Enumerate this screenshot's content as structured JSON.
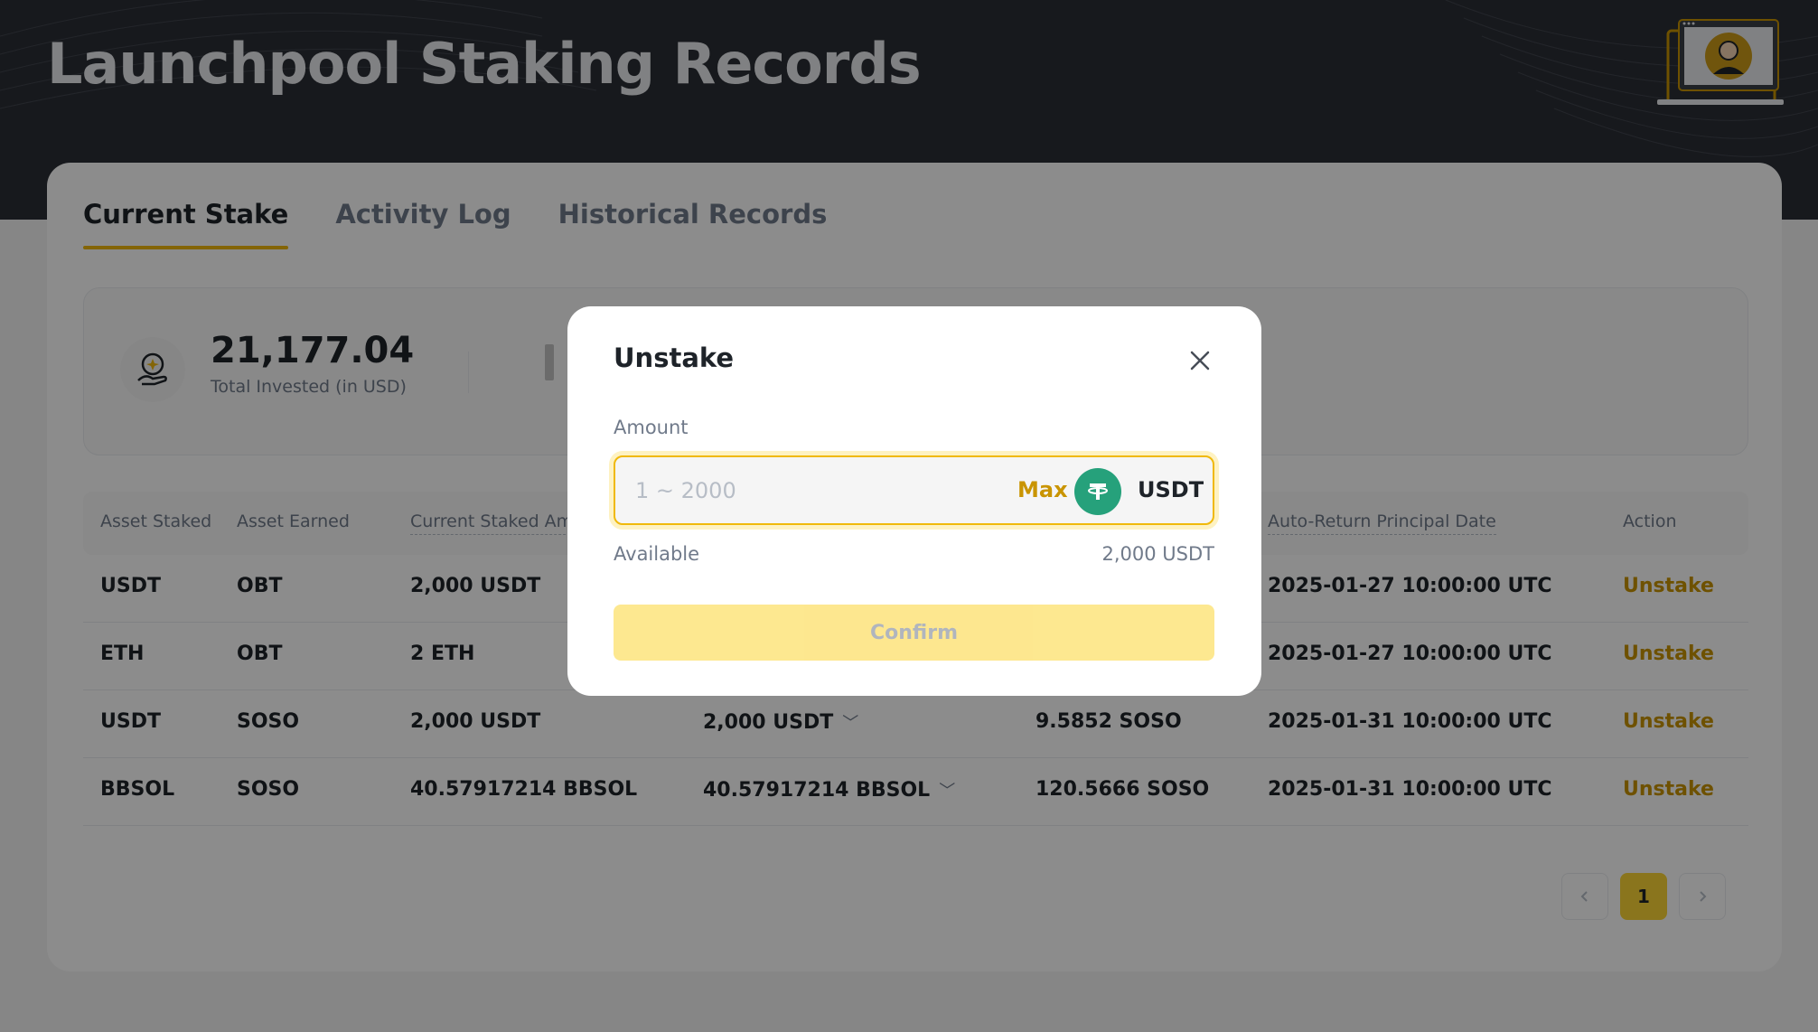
{
  "page": {
    "title": "Launchpool Staking Records"
  },
  "tabs": [
    {
      "label": "Current Stake",
      "active": true
    },
    {
      "label": "Activity Log",
      "active": false
    },
    {
      "label": "Historical Records",
      "active": false
    }
  ],
  "summary": {
    "total_invested_value": "21,177.04",
    "total_invested_label": "Total Invested (in USD)"
  },
  "table": {
    "headers": {
      "asset_staked": "Asset Staked",
      "asset_earned": "Asset Earned",
      "current_staked_amount": "Current Staked Amo",
      "auto_return_date": "Auto-Return Principal Date",
      "action": "Action"
    },
    "rows": [
      {
        "asset_staked": "USDT",
        "asset_earned": "OBT",
        "current_staked": "2,000 USDT",
        "staked_detail": "",
        "earned": "",
        "auto_return": "2025-01-27 10:00:00 UTC",
        "action": "Unstake"
      },
      {
        "asset_staked": "ETH",
        "asset_earned": "OBT",
        "current_staked": "2 ETH",
        "staked_detail": "",
        "earned": "",
        "auto_return": "2025-01-27 10:00:00 UTC",
        "action": "Unstake"
      },
      {
        "asset_staked": "USDT",
        "asset_earned": "SOSO",
        "current_staked": "2,000 USDT",
        "staked_detail": "2,000 USDT",
        "earned": "9.5852 SOSO",
        "auto_return": "2025-01-31 10:00:00 UTC",
        "action": "Unstake"
      },
      {
        "asset_staked": "BBSOL",
        "asset_earned": "SOSO",
        "current_staked": "40.57917214 BBSOL",
        "staked_detail": "40.57917214 BBSOL",
        "earned": "120.5666 SOSO",
        "auto_return": "2025-01-31 10:00:00 UTC",
        "action": "Unstake"
      }
    ]
  },
  "pagination": {
    "current_page": "1",
    "prev_icon": "chevron-left-icon",
    "next_icon": "chevron-right-icon"
  },
  "modal": {
    "title": "Unstake",
    "amount_label": "Amount",
    "amount_placeholder": "1 ~ 2000",
    "amount_value": "",
    "max_label": "Max",
    "coin": "USDT",
    "coin_icon": "tether-icon",
    "available_label": "Available",
    "available_value": "2,000 USDT",
    "confirm_label": "Confirm"
  },
  "colors": {
    "accent": "#f0b90b",
    "accent_text": "#c99400",
    "tether_green": "#26a17b",
    "header_bg": "#2b2f36"
  }
}
